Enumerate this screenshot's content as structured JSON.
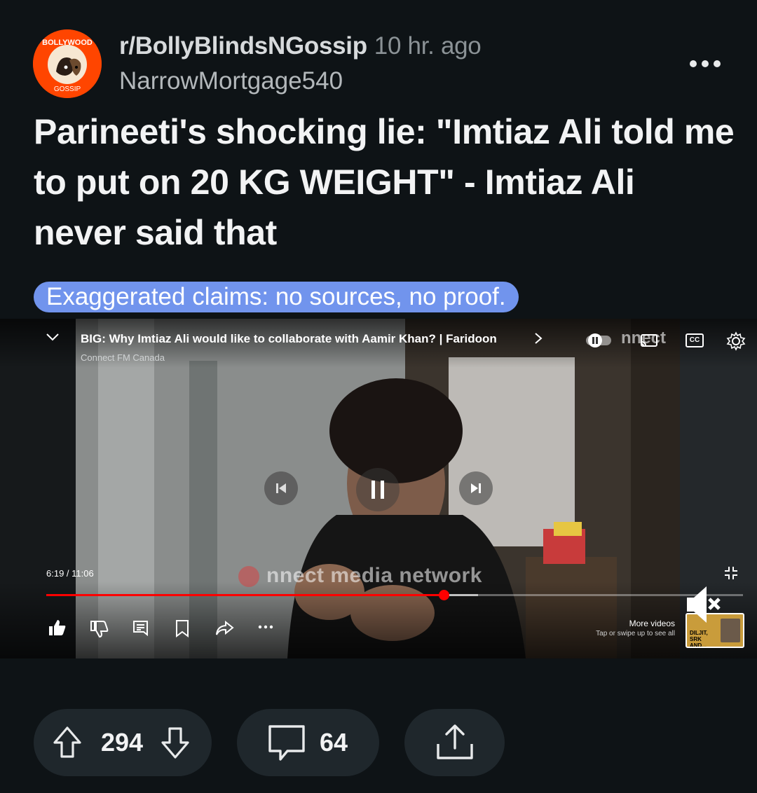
{
  "post": {
    "subreddit": "r/BollyBlindsNGossip",
    "age": "10 hr. ago",
    "author": "NarrowMortgage540",
    "title": "Parineeti's shocking lie: \"Imtiaz Ali told me to put on 20 KG WEIGHT\" - Imtiaz Ali never said that",
    "flair": "Exaggerated claims: no sources, no proof.",
    "subreddit_icon": {
      "top_text": "BOLLYWOOD",
      "bottom_text": "GOSSIP"
    }
  },
  "video": {
    "title": "BIG: Why Imtiaz Ali would like to collaborate with Aamir Khan? | Faridoon",
    "channel": "Connect FM Canada",
    "watermark": "nnect media network",
    "watermark_top": "nnect",
    "time": "6:19 / 11:06",
    "progress": 0.57,
    "buffered": 0.62,
    "more_videos": "More videos",
    "more_videos_hint": "Tap or swipe up to see all",
    "thumb_text": "DILJIT, SRK AND...",
    "cc_label": "CC"
  },
  "actions": {
    "score": "294",
    "comments": "64"
  },
  "colors": {
    "background": "#0e1316",
    "flair_bg": "#7194ed",
    "subreddit_icon": "#ff4500",
    "progress": "#ff0000",
    "pill_bg": "#1f272c"
  }
}
